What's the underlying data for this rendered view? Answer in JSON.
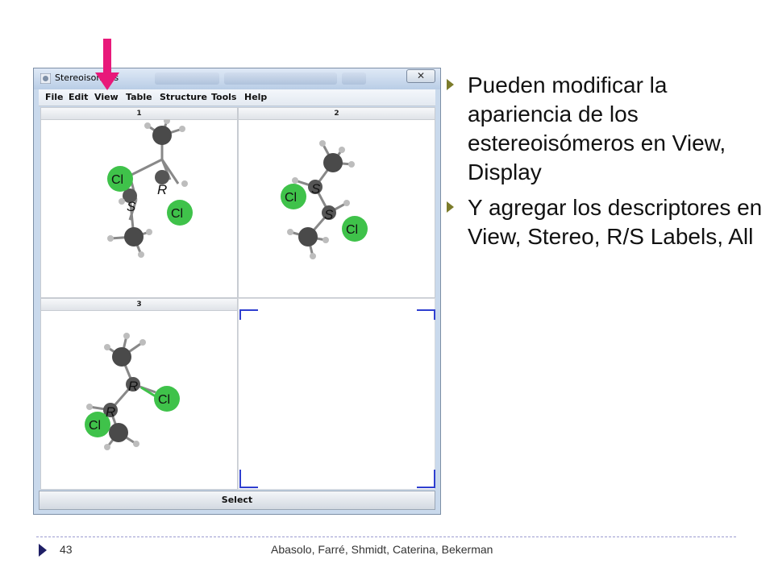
{
  "window": {
    "title": "Stereoisomers",
    "close_label": "✕",
    "menu": [
      "File",
      "Edit",
      "View",
      "Table",
      "Structure",
      "Tools",
      "Help"
    ],
    "panels": [
      "1",
      "2",
      "3"
    ],
    "select_label": "Select"
  },
  "molecules": {
    "labels": {
      "cl": "Cl",
      "r": "R",
      "s": "S"
    }
  },
  "slide": {
    "bullets": [
      "Pueden modificar la apariencia de los estereoisómeros en View, Display",
      "Y agregar los descriptores en View, Stereo, R/S Labels, All"
    ]
  },
  "footer": {
    "page_number": "43",
    "authors": "Abasolo, Farré, Shmidt, Caterina, Bekerman"
  },
  "colors": {
    "arrow": "#e8197a",
    "chlorine": "#3fc24a",
    "carbon": "#4a4a4a",
    "bullet": "#7b7b2a",
    "frame_corner": "#2f3fd0"
  }
}
